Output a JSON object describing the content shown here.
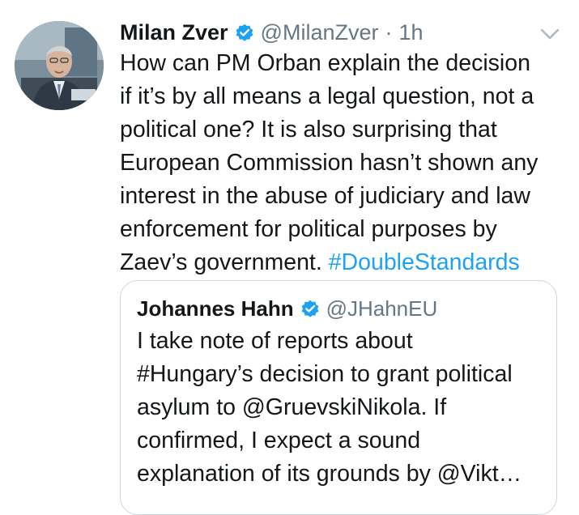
{
  "tweet": {
    "author": {
      "name": "Milan Zver",
      "handle": "@MilanZver",
      "verified": true
    },
    "separator": "·",
    "time": "1h",
    "text_lines": [
      "How can PM Orban explain the decision",
      "if it’s by all means a legal question, not a",
      "political one? It is also surprising that",
      "European Commission hasn’t shown any",
      "interest in the abuse of judiciary and law",
      "enforcement for political purposes by"
    ],
    "last_line_text": "Zaev’s government. ",
    "hashtag": "#DoubleStandards"
  },
  "quoted_tweet": {
    "author": {
      "name": "Johannes Hahn",
      "handle": "@JHahnEU",
      "verified": true
    },
    "text_lines": [
      "I take note of reports about",
      "#Hungary’s decision to grant political",
      "asylum to @GruevskiNikola. If",
      "confirmed, I expect a sound",
      "explanation of its grounds by @Vikt…"
    ]
  },
  "icons": {
    "verified_badge": "verified-badge-icon",
    "caret": "chevron-down-icon"
  },
  "colors": {
    "link_blue": "#1da1f2",
    "secondary_gray": "#657786",
    "text": "#14171a",
    "border": "#ccd6dd"
  }
}
